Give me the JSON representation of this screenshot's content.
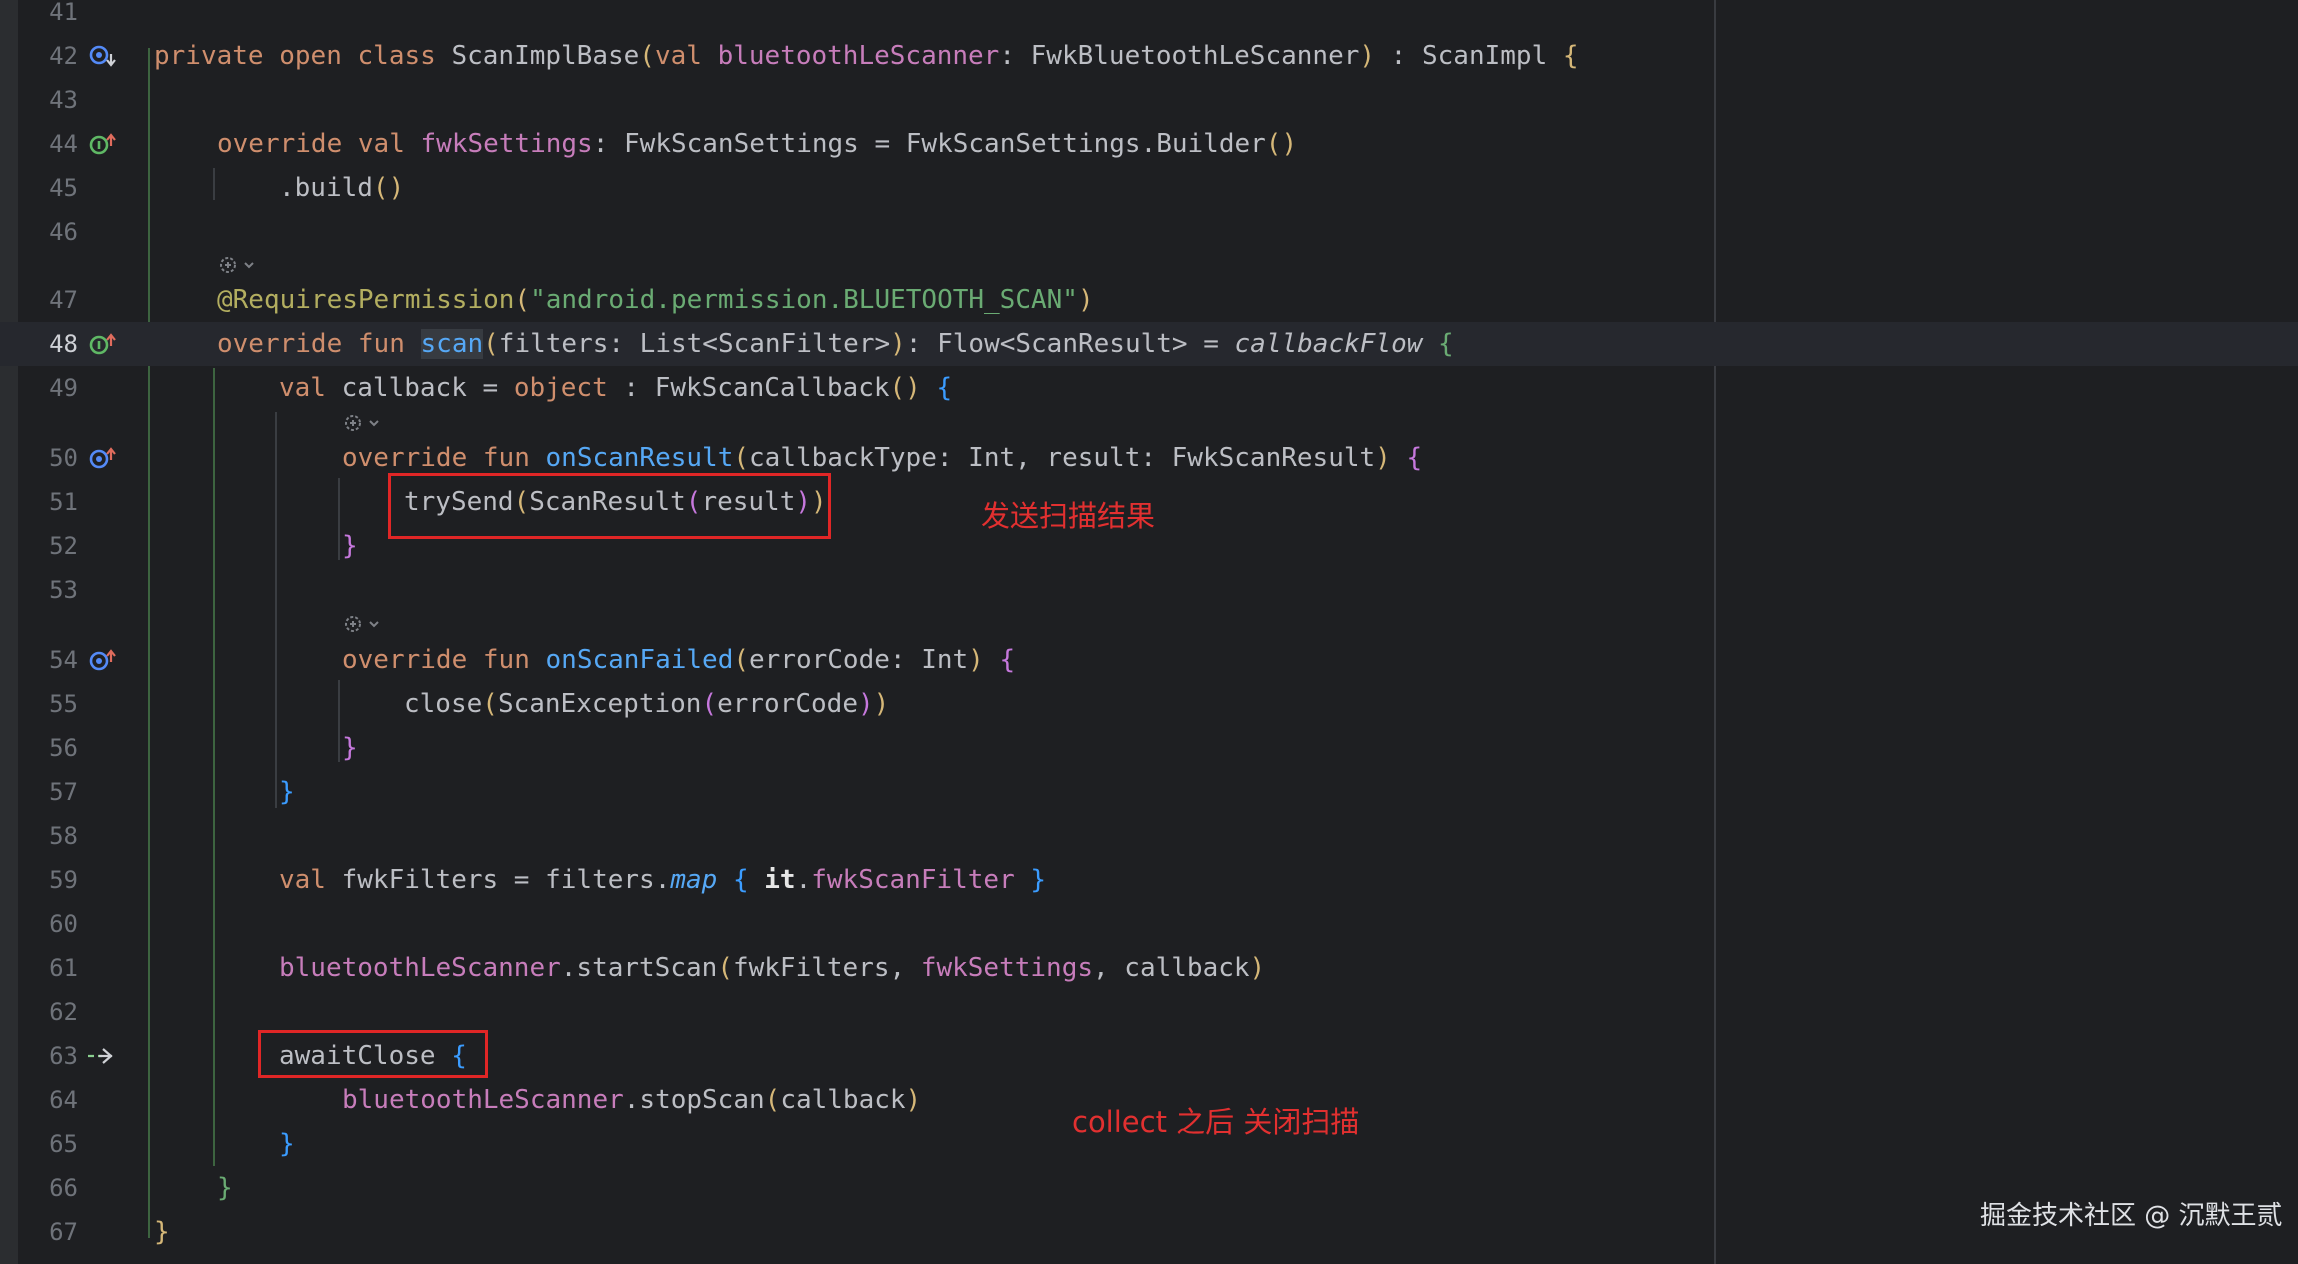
{
  "editor": {
    "line_numbers": [
      "41",
      "42",
      "43",
      "44",
      "45",
      "46",
      "47",
      "48",
      "49",
      "50",
      "51",
      "52",
      "53",
      "54",
      "55",
      "56",
      "57",
      "58",
      "59",
      "60",
      "61",
      "62",
      "63",
      "64",
      "65",
      "66",
      "67"
    ],
    "current_line": "48"
  },
  "code": {
    "l42": {
      "private": "private",
      "open": "open",
      "class": "class",
      "name": "ScanImplBase",
      "p1": "(",
      "val": "val",
      "param": "bluetoothLeScanner",
      "ptype": ": FwkBluetoothLeScanner",
      "p2": ")",
      "impl": " : ScanImpl ",
      "brace": "{"
    },
    "l44": {
      "override": "override",
      "val": "val",
      "prop": "fwkSettings",
      "rest": ": FwkScanSettings = FwkScanSettings.Builder",
      "paren": "()"
    },
    "l45": {
      "call": ".build",
      "paren": "()"
    },
    "l47": {
      "ann": "@RequiresPermission",
      "p1": "(",
      "str": "\"android.permission.BLUETOOTH_SCAN\"",
      "p2": ")"
    },
    "l48": {
      "override": "override",
      "fun": "fun",
      "name": "scan",
      "p1": "(",
      "params": "filters: List<ScanFilter>",
      "p2": ")",
      "ret": ": Flow<ScanResult> = ",
      "builder": "callbackFlow",
      "brace": "{"
    },
    "l49": {
      "val": "val",
      "rest": " callback = ",
      "object": "object",
      "type": " : FwkScanCallback",
      "paren": "()",
      "brace": "{"
    },
    "l50": {
      "override": "override",
      "fun": "fun",
      "name": "onScanResult",
      "p1": "(",
      "params": "callbackType: Int, result: FwkScanResult",
      "p2": ")",
      "brace": "{"
    },
    "l51": {
      "call": "trySend",
      "p1": "(",
      "inner": "ScanResult",
      "p2": "(",
      "arg": "result",
      "p3": ")",
      "p4": ")"
    },
    "l52": {
      "brace": "}"
    },
    "l54": {
      "override": "override",
      "fun": "fun",
      "name": "onScanFailed",
      "p1": "(",
      "params": "errorCode: Int",
      "p2": ")",
      "brace": "{"
    },
    "l55": {
      "call": "close",
      "p1": "(",
      "inner": "ScanException",
      "p2": "(",
      "arg": "errorCode",
      "p3": ")",
      "p4": ")"
    },
    "l56": {
      "brace": "}"
    },
    "l57": {
      "brace": "}"
    },
    "l59": {
      "val": "val",
      "rest": " fwkFilters = filters.",
      "map": "map",
      "b1": "{",
      "it": "it",
      "dot": ".",
      "prop": "fwkScanFilter",
      "b2": "}"
    },
    "l61": {
      "recv": "bluetoothLeScanner",
      "call": ".startScan",
      "p1": "(",
      "a1": "fwkFilters, ",
      "a2": "fwkSettings",
      "a3": ", callback",
      "p2": ")"
    },
    "l63": {
      "call": "awaitClose ",
      "brace": "{"
    },
    "l64": {
      "recv": "bluetoothLeScanner",
      "call": ".stopScan",
      "p1": "(",
      "arg": "callback",
      "p2": ")"
    },
    "l65": {
      "brace": "}"
    },
    "l66": {
      "brace": "}"
    },
    "l67": {
      "brace": "}"
    }
  },
  "annotations": {
    "send_result": "发送扫描结果",
    "close_after_collect": "collect 之后 关闭扫描"
  },
  "watermark": "掘金技术社区 @ 沉默王贰",
  "icons": {
    "override_icon": "overrides-method-icon",
    "implement_icon": "implements-method-icon",
    "lambda_icon": "suspend-lambda-icon",
    "inlay_icon": "code-vision-icon"
  },
  "colors": {
    "background": "#1e1f22",
    "keyword": "#cf8e6d",
    "function": "#56a8f5",
    "property": "#c77dbb",
    "string": "#6aab73",
    "annotation": "#b3ae60",
    "highlight_box": "#e02626"
  }
}
